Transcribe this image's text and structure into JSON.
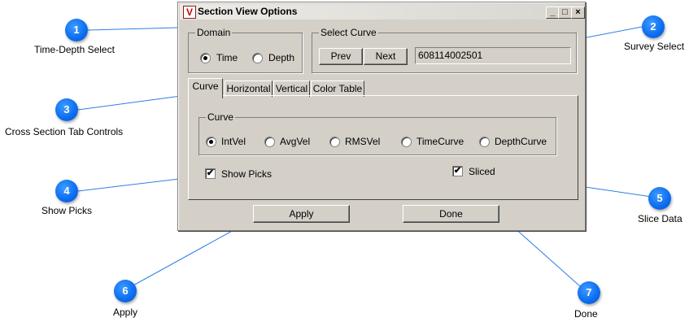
{
  "window": {
    "title": "Section View Options",
    "controls": {
      "minimize": "_",
      "maximize": "□",
      "close": "×"
    }
  },
  "domain": {
    "title": "Domain",
    "options": [
      {
        "label": "Time",
        "selected": true
      },
      {
        "label": "Depth",
        "selected": false
      }
    ]
  },
  "select_curve": {
    "title": "Select Curve",
    "prev_label": "Prev",
    "next_label": "Next",
    "value": "608114002501"
  },
  "tabs": [
    {
      "label": "Curve",
      "active": true
    },
    {
      "label": "Horizontal",
      "active": false
    },
    {
      "label": "Vertical",
      "active": false
    },
    {
      "label": "Color Table",
      "active": false
    }
  ],
  "curve_group": {
    "title": "Curve",
    "options": [
      {
        "label": "IntVel",
        "selected": true
      },
      {
        "label": "AvgVel",
        "selected": false
      },
      {
        "label": "RMSVel",
        "selected": false
      },
      {
        "label": "TimeCurve",
        "selected": false
      },
      {
        "label": "DepthCurve",
        "selected": false
      }
    ]
  },
  "show_picks": {
    "label": "Show Picks",
    "checked": true
  },
  "sliced": {
    "label": "Sliced",
    "checked": true
  },
  "apply_label": "Apply",
  "done_label": "Done",
  "callouts": [
    {
      "number": "1",
      "label": "Time-Depth Select"
    },
    {
      "number": "2",
      "label": "Survey Select"
    },
    {
      "number": "3",
      "label": "Cross Section Tab Controls"
    },
    {
      "number": "4",
      "label": "Show Picks"
    },
    {
      "number": "5",
      "label": "Slice Data"
    },
    {
      "number": "6",
      "label": "Apply"
    },
    {
      "number": "7",
      "label": "Done"
    }
  ],
  "colors": {
    "callout": "#0a6cf0",
    "dialog_bg": "#d4d0c8",
    "leader_line": "#2b7fe6"
  }
}
